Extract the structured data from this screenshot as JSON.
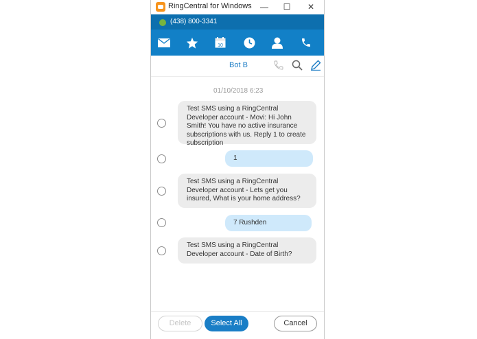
{
  "window": {
    "title": "RingCentral for Windows",
    "minimize": "—",
    "maximize": "☐",
    "close": "✕"
  },
  "phone_bar": {
    "number": "(438) 800-3341",
    "status_color": "#77b43f"
  },
  "nav": [
    {
      "name": "messages-nav-icon",
      "icon": "envelope"
    },
    {
      "name": "favorites-nav-icon",
      "icon": "star"
    },
    {
      "name": "calendar-nav-icon",
      "icon": "calendar",
      "text": "10"
    },
    {
      "name": "recent-calls-nav-icon",
      "icon": "clock"
    },
    {
      "name": "contacts-nav-icon",
      "icon": "person"
    },
    {
      "name": "phone-nav-icon",
      "icon": "phone"
    }
  ],
  "conversation": {
    "name": "Bot B",
    "timestamp": "01/10/2018 6:23",
    "messages": [
      {
        "direction": "in",
        "text": "Test SMS using a RingCentral Developer account - Movi: Hi John Smith! You have no active insurance subscriptions with us. Reply 1 to create subscription"
      },
      {
        "direction": "out",
        "text": "1"
      },
      {
        "direction": "in",
        "text": "Test SMS using a RingCentral Developer account - Lets get you insured, What is your home address?"
      },
      {
        "direction": "out",
        "text": "7 Rushden"
      },
      {
        "direction": "in",
        "text": "Test SMS using a RingCentral Developer account - Date of Birth?"
      }
    ]
  },
  "footer": {
    "delete_label": "Delete",
    "select_all_label": "Select All",
    "cancel_label": "Cancel"
  },
  "colors": {
    "nav_bar": "#1280c7",
    "phone_bar": "#0d6fae",
    "incoming_bubble": "#ececec",
    "outgoing_bubble": "#cfe9fb",
    "accent": "#1a7ec6"
  }
}
